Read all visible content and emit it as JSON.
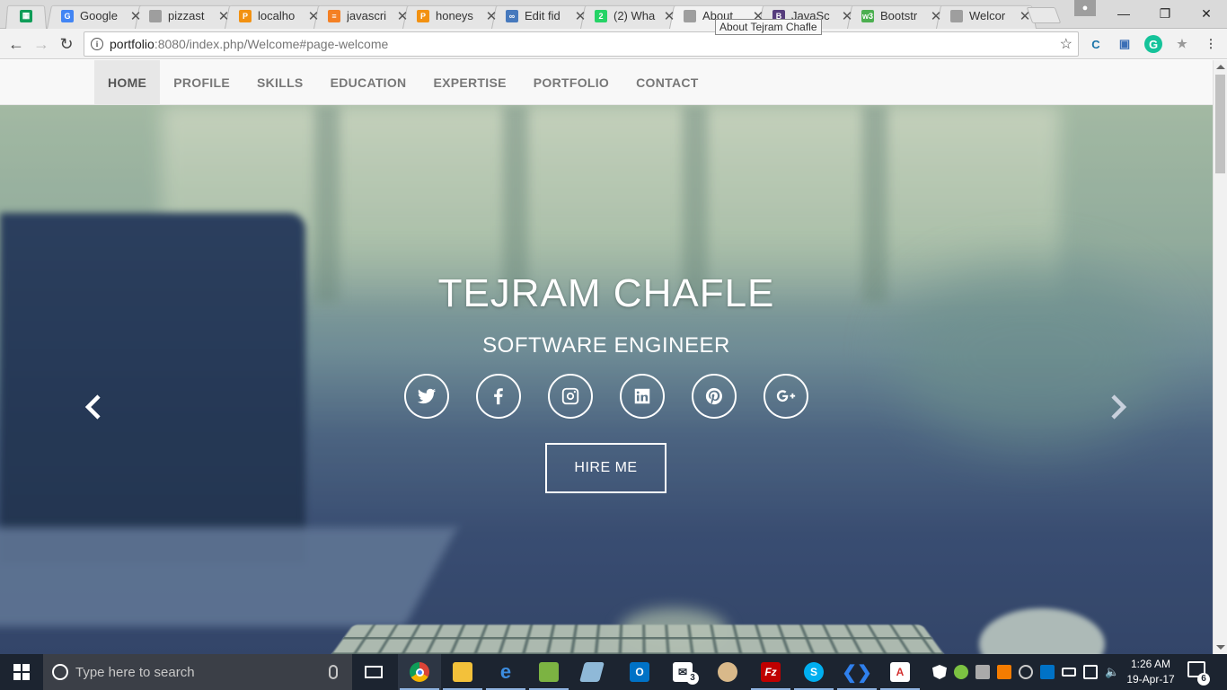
{
  "browser": {
    "tabs": [
      {
        "title": "",
        "favicon": "sheets-icon",
        "color": "#0f9d58",
        "glyph": "▦"
      },
      {
        "title": "Google",
        "favicon": "google-icon",
        "color": "#4285f4",
        "glyph": "G"
      },
      {
        "title": "pizzast",
        "favicon": "page-icon",
        "color": "#9e9e9e",
        "glyph": ""
      },
      {
        "title": "localho",
        "favicon": "phpmyadmin-icon",
        "color": "#f29111",
        "glyph": "P"
      },
      {
        "title": "javascri",
        "favicon": "stackoverflow-icon",
        "color": "#f48024",
        "glyph": "≡"
      },
      {
        "title": "honeys",
        "favicon": "phpmyadmin-icon",
        "color": "#f29111",
        "glyph": "P"
      },
      {
        "title": "Edit fid",
        "favicon": "jsfiddle-icon",
        "color": "#4679bd",
        "glyph": "∞"
      },
      {
        "title": "(2) Wha",
        "favicon": "whatsapp-icon",
        "color": "#25d366",
        "glyph": "2"
      },
      {
        "title": "About",
        "favicon": "page-icon",
        "color": "#9e9e9e",
        "glyph": ""
      },
      {
        "title": "JavaSc",
        "favicon": "bootstrap-icon",
        "color": "#563d7c",
        "glyph": "B"
      },
      {
        "title": "Bootstr",
        "favicon": "w3schools-icon",
        "color": "#4caf50",
        "glyph": "w3"
      },
      {
        "title": "Welcor",
        "favicon": "page-icon",
        "color": "#9e9e9e",
        "glyph": ""
      }
    ],
    "active_tab_index": 8,
    "tooltip": "About Tejram Chafle",
    "url_host": "portfolio",
    "url_path": ":8080/index.php/Welcome#page-welcome"
  },
  "site": {
    "nav": [
      "HOME",
      "PROFILE",
      "SKILLS",
      "EDUCATION",
      "EXPERTISE",
      "PORTFOLIO",
      "CONTACT"
    ],
    "active_nav": 0,
    "hero_title": "TEJRAM CHAFLE",
    "hero_subtitle": "SOFTWARE ENGINEER",
    "socials": [
      "twitter-icon",
      "facebook-icon",
      "instagram-icon",
      "linkedin-icon",
      "pinterest-icon",
      "google-plus-icon"
    ],
    "hire_label": "HIRE ME"
  },
  "taskbar": {
    "search_placeholder": "Type here to search",
    "time": "1:26 AM",
    "date": "19-Apr-17",
    "mail_badge": "3",
    "notifications_badge": "6"
  }
}
